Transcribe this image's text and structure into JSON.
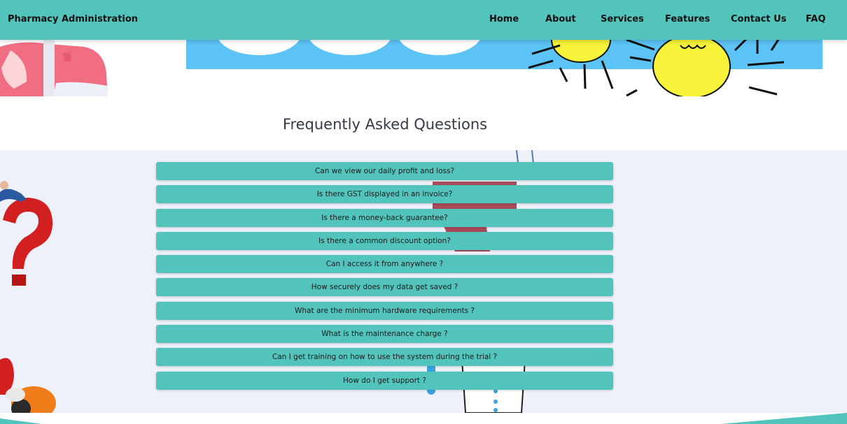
{
  "navbar": {
    "brand": "Pharmacy Administration",
    "items": [
      {
        "label": "Home"
      },
      {
        "label": "About"
      },
      {
        "label": "Services"
      },
      {
        "label": "Features"
      },
      {
        "label": "Contact Us"
      },
      {
        "label": "FAQ"
      }
    ]
  },
  "faq": {
    "title": "Frequently Asked Questions",
    "questions": [
      "Can we view our daily profit and loss?",
      "Is there GST displayed in an invoice?",
      "Is there a money-back guarantee?",
      "Is there a common discount option?",
      "Can I access it from anywhere ?",
      "How securely does my data get saved ?",
      "What are the minimum hardware requirements ?",
      "What is the maintenance charge ?",
      "Can I get training on how to use the system during the trial ?",
      "How do I get support ?"
    ]
  },
  "colors": {
    "accent": "#53c4bb",
    "section_bg": "#eef0fa",
    "banner_blue": "#5bc3f5"
  }
}
